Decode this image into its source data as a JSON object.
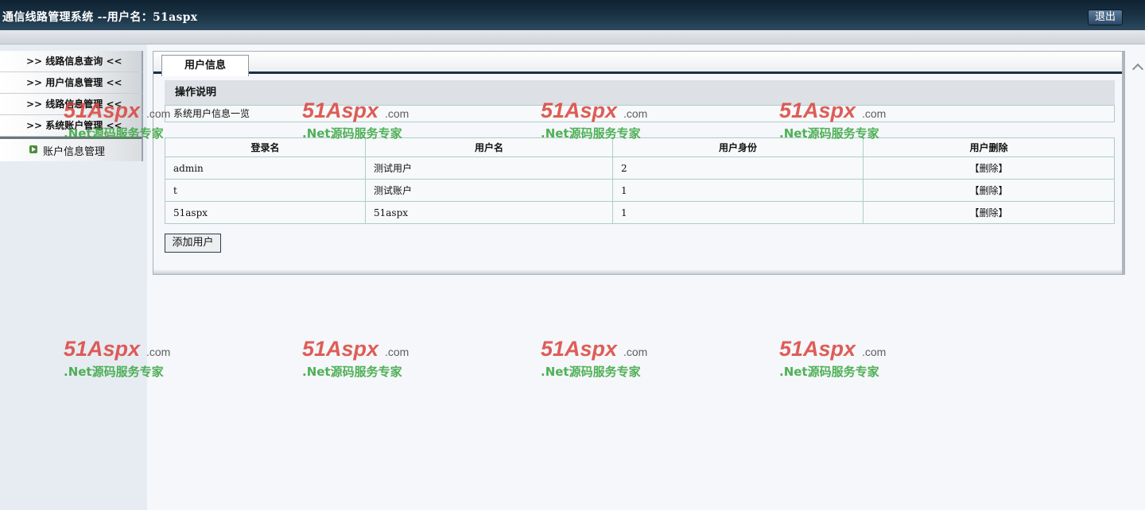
{
  "header": {
    "title": "通信线路管理系统 --用户名：51aspx",
    "logout_label": "退出"
  },
  "sidebar": {
    "items": [
      {
        "label": ">>  线路信息查询  <<"
      },
      {
        "label": ">>  用户信息管理  <<"
      },
      {
        "label": ">>  线路信息管理  <<"
      },
      {
        "label": ">>  系统账户管理  <<"
      }
    ],
    "subitem": {
      "label": "账户信息管理",
      "icon": "arrow-bullet-icon"
    }
  },
  "main": {
    "tab_label": "用户信息",
    "op_title": "操作说明",
    "op_desc": "系统用户信息一览",
    "table": {
      "headers": [
        "登录名",
        "用户名",
        "用户身份",
        "用户删除"
      ],
      "rows": [
        {
          "login": "admin",
          "name": "测试用户",
          "role": "2",
          "delete": "【删除】"
        },
        {
          "login": "t",
          "name": "测试账户",
          "role": "1",
          "delete": "【删除】"
        },
        {
          "login": "51aspx",
          "name": "51aspx",
          "role": "1",
          "delete": "【删除】"
        }
      ]
    },
    "add_button": "添加用户"
  },
  "watermark": {
    "brand": "51Aspx",
    "suffix": ".com",
    "tagline": ".Net源码服务专家",
    "brand_color": "#d9423a",
    "tagline_color": "#33a33a"
  }
}
